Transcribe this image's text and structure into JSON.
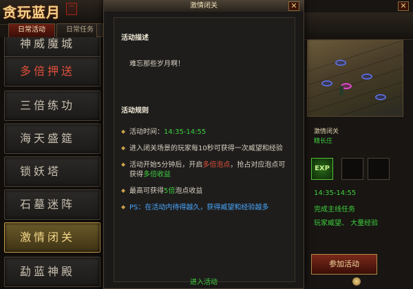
{
  "logo": {
    "title": "贪玩蓝月",
    "seal": "一"
  },
  "tabs": {
    "active": "日常活动",
    "idle": "日常任务"
  },
  "activity_list": [
    {
      "label": "神威魔城",
      "state": "normal"
    },
    {
      "label": "多倍押送",
      "state": "hot"
    },
    {
      "label": "三倍练功",
      "state": "normal"
    },
    {
      "label": "海天盛筵",
      "state": "normal"
    },
    {
      "label": "锁妖塔",
      "state": "normal"
    },
    {
      "label": "石墓迷阵",
      "state": "normal"
    },
    {
      "label": "激情闭关",
      "state": "selected"
    },
    {
      "label": "勐蓝神殿",
      "state": "normal"
    }
  ],
  "dialog": {
    "title": "激情闭关",
    "close_icon": "✕",
    "desc_title": "活动描述",
    "desc_text": "难忘那些岁月啊！",
    "rules_title": "活动规则",
    "rules": {
      "r1_prefix": "活动时间：",
      "r1_time": "14:35-14:55",
      "r2": "进入闭关场景的玩家每10秒可获得一次威望和经验",
      "r3_a": "活动开始5分钟后，开启",
      "r3_hl": "多倍泡点",
      "r3_b": "，抢占对应泡点可获得",
      "r3_hl2": "多倍收益",
      "r4_a": "最高可获得",
      "r4_hl": "5倍",
      "r4_b": "泡点收益",
      "ps": "PS：在活动内待得越久，获得威望和经验越多"
    },
    "join_link": "进入活动"
  },
  "right": {
    "close_icon": "✕",
    "name_label": "激情闭关",
    "place_label": "精长庄",
    "exp_label": "EXP",
    "time": "14:35-14:55",
    "requirement": "完成主线任务",
    "reward": "玩家威望、 大量经验",
    "join_button": "参加活动"
  },
  "colors": {
    "accent_gold": "#c9a04a",
    "time_green": "#3ed03e",
    "ps_blue": "#4aa8ff",
    "hot_red": "#e0503c"
  }
}
